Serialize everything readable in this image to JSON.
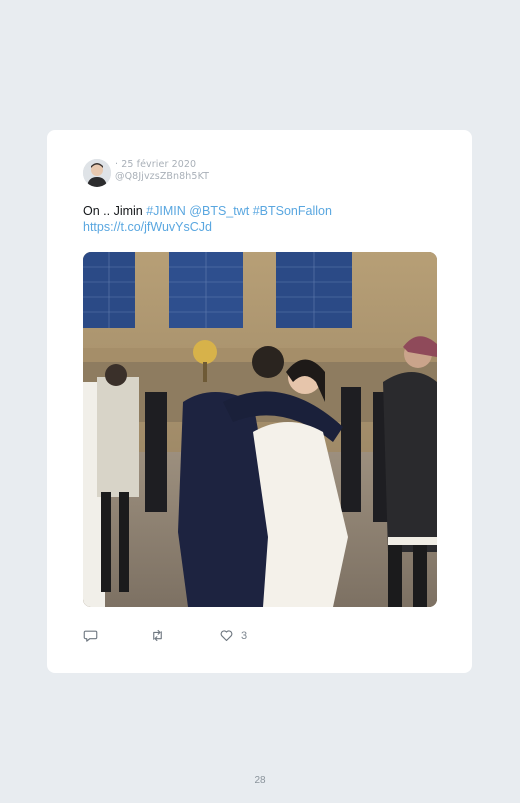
{
  "tweet": {
    "date": "· 25 février 2020",
    "handle": "@Q8JjvzsZBn8h5KT",
    "text_plain": "On .. Jimin ",
    "tag1": "#JIMIN",
    "mention": "@BTS_twt",
    "tag2": "#BTSonFallon",
    "url": "https://t.co/jfWuvYsCJd",
    "likes": "3"
  },
  "page_number": "28",
  "icons": {
    "reply": "reply-icon",
    "retweet": "retweet-icon",
    "like": "heart-icon"
  }
}
